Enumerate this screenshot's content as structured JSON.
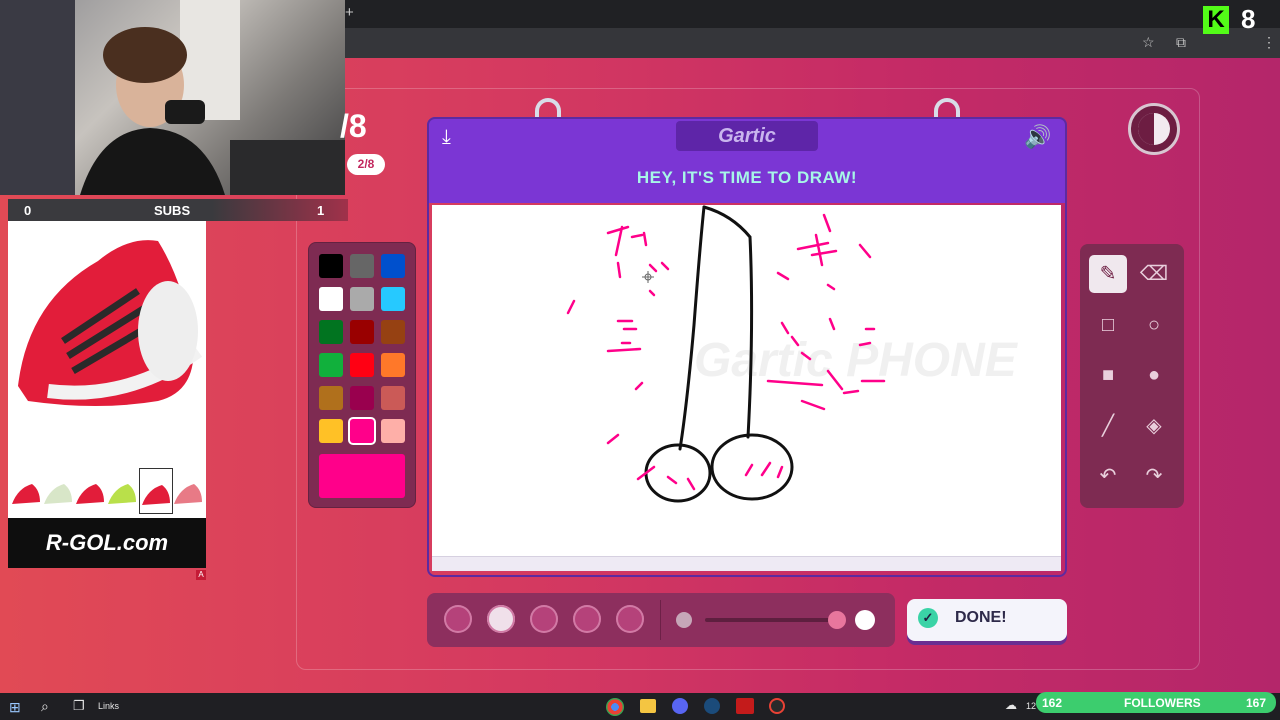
{
  "browser": {
    "new_tab": "+"
  },
  "stream": {
    "subs_left": "0",
    "subs_label": "SUBS",
    "subs_right": "1",
    "ad_brand": "R-GOL.com",
    "ad_badge": "A",
    "kick_count": "8",
    "kick_logo": "K",
    "followers_left": "162",
    "followers_label": "FOLLOWERS",
    "followers_right": "167"
  },
  "game": {
    "round_big": "/8",
    "round_small": "2/8",
    "card_title": "Gartic",
    "prompt": "HEY, IT'S TIME TO DRAW!",
    "watermark": "Gartic PHONE",
    "done_label": "DONE!",
    "selected_color": "#ff008a",
    "palette": [
      [
        "#000000",
        "#666666",
        "#0050cd"
      ],
      [
        "#ffffff",
        "#aaaaaa",
        "#26c9ff"
      ],
      [
        "#017420",
        "#990000",
        "#964112"
      ],
      [
        "#11b03c",
        "#ff0013",
        "#ff7829"
      ],
      [
        "#b0701c",
        "#99004e",
        "#cb5a57"
      ],
      [
        "#ffc126",
        "#ff008a",
        "#feafa8"
      ]
    ],
    "brush_sizes": [
      "1",
      "2",
      "3",
      "4",
      "5"
    ],
    "selected_brush": "2"
  },
  "taskbar": {
    "links_label": "Links",
    "tray_text": "12"
  }
}
